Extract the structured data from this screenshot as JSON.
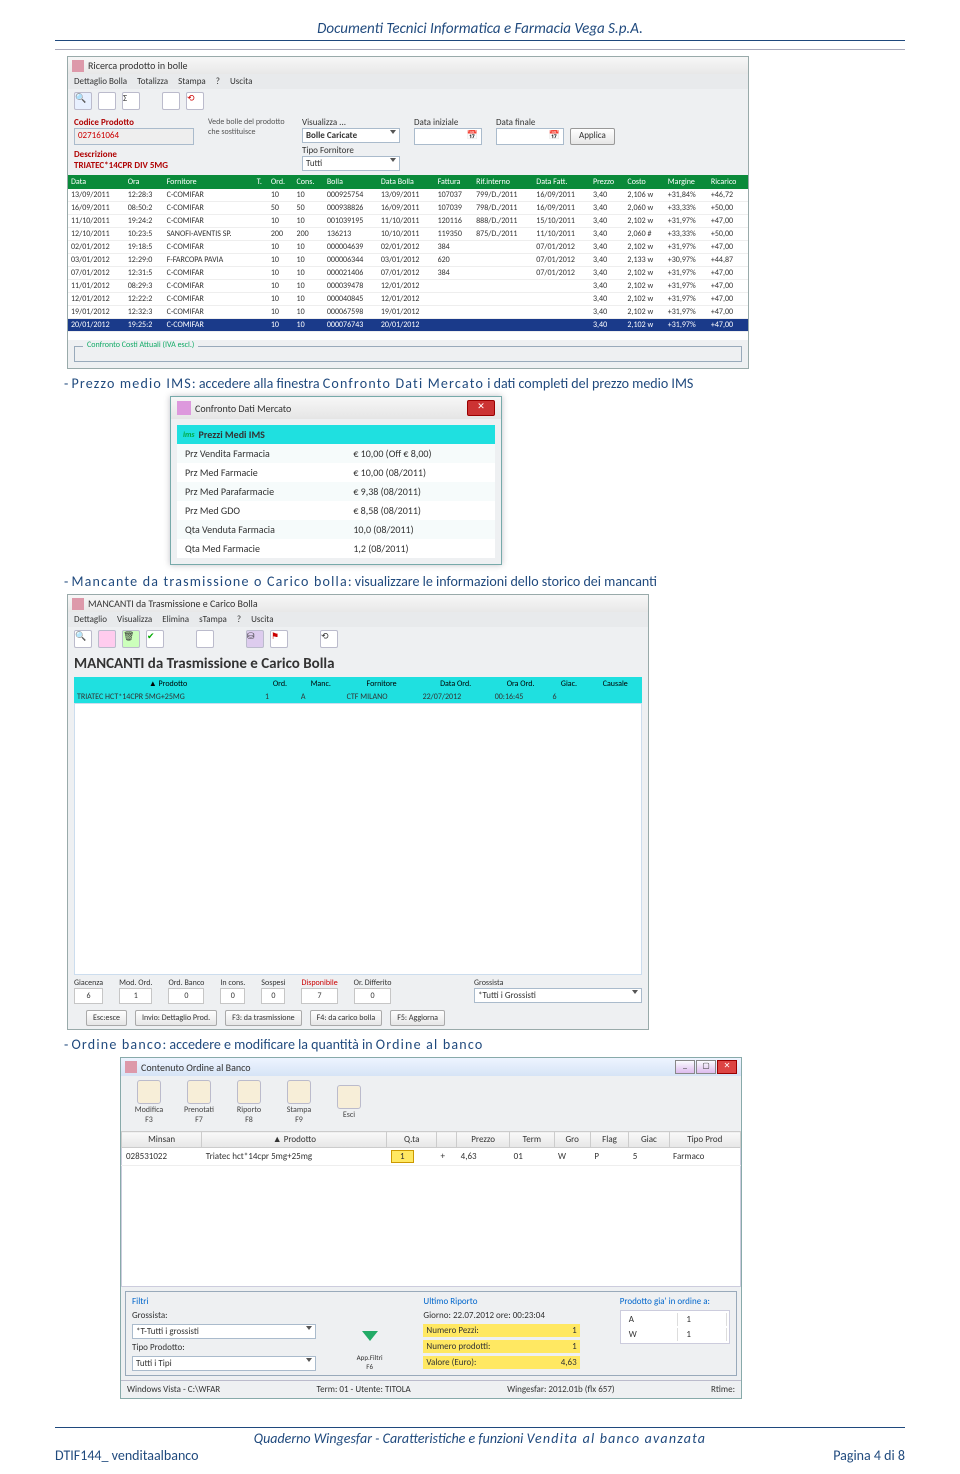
{
  "doc_header": "Documenti Tecnici Informatica e Farmacia Vega S.p.A.",
  "ricerca": {
    "title": "Ricerca prodotto in bolle",
    "menu": [
      "Dettaglio Bolla",
      "Totalizza",
      "Stampa",
      "?",
      "Uscita"
    ],
    "labels": {
      "codice": "Codice Prodotto",
      "codice_val": "027161064",
      "descrizione": "Descrizione",
      "descrizione_val": "TRIATEC*14CPR DIV 5MG",
      "note": "Vede bolle del prodotto che sostituisce",
      "visualizza": "Visualizza ...",
      "bolle_caricate": "Bolle Caricate",
      "tipo_fornitore": "Tipo Fornitore",
      "tutti": "Tutti",
      "data_iniziale": "Data iniziale",
      "data_finale": "Data finale",
      "applica": "Applica"
    },
    "cols": [
      "Data",
      "Ora",
      "Fornitore",
      "T.",
      "Ord.",
      "Cons.",
      "Bolla",
      "Data Bolla",
      "Fattura",
      "Rif.interno",
      "Data Fatt.",
      "Prezzo",
      "Costo",
      "Margine",
      "Ricarico"
    ],
    "rows": [
      [
        "13/09/2011",
        "12:28:3",
        "C-COMIFAR",
        "",
        "10",
        "10",
        "000925754",
        "13/09/2011",
        "107037",
        "799/D./2011",
        "16/09/2011",
        "3,40",
        "2,106 w",
        "+31,84%",
        "+46,72"
      ],
      [
        "16/09/2011",
        "08:50:2",
        "C-COMIFAR",
        "",
        "50",
        "50",
        "000938826",
        "16/09/2011",
        "107039",
        "798/D./2011",
        "16/09/2011",
        "3,40",
        "2,060 w",
        "+33,33%",
        "+50,00"
      ],
      [
        "11/10/2011",
        "19:24:2",
        "C-COMIFAR",
        "",
        "10",
        "10",
        "001039195",
        "11/10/2011",
        "120116",
        "888/D./2011",
        "15/10/2011",
        "3,40",
        "2,102 w",
        "+31,97%",
        "+47,00"
      ],
      [
        "12/10/2011",
        "10:23:5",
        "SANOFI-AVENTIS SP.",
        "",
        "200",
        "200",
        "136213",
        "10/10/2011",
        "119350",
        "875/D./2011",
        "11/10/2011",
        "3,40",
        "2,060 #",
        "+33,33%",
        "+50,00"
      ],
      [
        "02/01/2012",
        "19:18:5",
        "C-COMIFAR",
        "",
        "10",
        "10",
        "000004639",
        "02/01/2012",
        "384",
        "",
        "07/01/2012",
        "3,40",
        "2,102 w",
        "+31,97%",
        "+47,00"
      ],
      [
        "03/01/2012",
        "12:29:0",
        "F-FARCOPA PAVIA",
        "",
        "10",
        "10",
        "000006344",
        "03/01/2012",
        "620",
        "",
        "07/01/2012",
        "3,40",
        "2,133 w",
        "+30,97%",
        "+44,87"
      ],
      [
        "07/01/2012",
        "12:31:5",
        "C-COMIFAR",
        "",
        "10",
        "10",
        "000021406",
        "07/01/2012",
        "384",
        "",
        "07/01/2012",
        "3,40",
        "2,102 w",
        "+31,97%",
        "+47,00"
      ],
      [
        "11/01/2012",
        "08:29:3",
        "C-COMIFAR",
        "",
        "10",
        "10",
        "000039478",
        "12/01/2012",
        "",
        "",
        "",
        "3,40",
        "2,102 w",
        "+31,97%",
        "+47,00"
      ],
      [
        "12/01/2012",
        "12:22:2",
        "C-COMIFAR",
        "",
        "10",
        "10",
        "000040845",
        "12/01/2012",
        "",
        "",
        "",
        "3,40",
        "2,102 w",
        "+31,97%",
        "+47,00"
      ],
      [
        "19/01/2012",
        "12:32:3",
        "C-COMIFAR",
        "",
        "10",
        "10",
        "000067598",
        "19/01/2012",
        "",
        "",
        "",
        "3,40",
        "2,102 w",
        "+31,97%",
        "+47,00"
      ],
      [
        "20/01/2012",
        "19:25:2",
        "C-COMIFAR",
        "",
        "10",
        "10",
        "000076743",
        "20/01/2012",
        "",
        "",
        "",
        "3,40",
        "2,102 w",
        "+31,97%",
        "+47,00"
      ]
    ],
    "groupbox": "Confronto Costi Attuali (IVA escl.)"
  },
  "para1_prefix": "- ",
  "para1_lead": "Prezzo medio IMS",
  "para1_rest": ": accedere alla finestra ",
  "para1_lead2": "Confronto Dati Mercato",
  "para1_rest2": " i dati completi del prezzo medio IMS",
  "confronto": {
    "title": "Confronto Dati Mercato",
    "band": "Prezzi Medi IMS",
    "band_prefix": "ims",
    "rows": [
      [
        "Prz Vendita Farmacia",
        "€ 10,00 (Off € 8,00)"
      ],
      [
        "Prz Med Farmacie",
        "€ 10,00 (08/2011)"
      ],
      [
        "Prz Med Parafarmacie",
        "€ 9,38 (08/2011)"
      ],
      [
        "Prz Med GDO",
        "€ 8,58 (08/2011)"
      ],
      [
        "Qta Venduta Farmacia",
        "10,0 (08/2011)"
      ],
      [
        "Qta Med Farmacie",
        "1,2 (08/2011)"
      ]
    ]
  },
  "para2_prefix": "- ",
  "para2_lead": "Mancante da trasmissione o Carico bolla",
  "para2_rest": ": visualizzare le informazioni dello storico dei mancanti",
  "mancanti": {
    "wintitle": "MANCANTI da Trasmissione e Carico Bolla",
    "menu": [
      "Dettaglio",
      "Visualizza",
      "Elimina",
      "sTampa",
      "?",
      "Uscita"
    ],
    "heading": "MANCANTI da Trasmissione e Carico Bolla",
    "cols": [
      "▲ Prodotto",
      "Ord.",
      "Manc.",
      "Fornitore",
      "Data Ord.",
      "Ora Ord.",
      "Giac.",
      "Causale"
    ],
    "row": [
      "TRIATEC HCT*14CPR 5MG+25MG",
      "1",
      "A",
      "CTF MILANO",
      "22/07/2012",
      "00:16:45",
      "6",
      ""
    ],
    "status_labels": [
      "Giacenza",
      "Mod. Ord.",
      "Ord. Banco",
      "In cons.",
      "Sospesi",
      "Disponibile",
      "Or. Differito"
    ],
    "status_vals": [
      "6",
      "1",
      "0",
      "0",
      "0",
      "7",
      "0"
    ],
    "grossista_lbl": "Grossista",
    "grossista_val": "*Tutti i Grossisti",
    "fbtns": [
      "Esc:esce",
      "Invio: Dettaglio Prod.",
      "F3: da trasmissione",
      "F4: da carico bolla",
      "F5: Aggiorna"
    ]
  },
  "para3_prefix": "- ",
  "para3_lead": "Ordine banco",
  "para3_rest": ": accedere e modificare la quantità in ",
  "para3_lead2": "Ordine al banco",
  "ordine": {
    "wintitle": "Contenuto Ordine al Banco",
    "icons": [
      [
        "Modifica",
        "F3"
      ],
      [
        "Prenotati",
        "F7"
      ],
      [
        "Riporto",
        "F8"
      ],
      [
        "Stampa",
        "F9"
      ],
      [
        "Esci",
        ""
      ]
    ],
    "cols": [
      "Minsan",
      "▲ Prodotto",
      "Q.ta",
      "",
      "Prezzo",
      "Term",
      "Gro",
      "Flag",
      "Giac",
      "Tipo Prod"
    ],
    "row": [
      "028531022",
      "Triatec hct*14cpr 5mg+25mg",
      "1",
      "+",
      "4,63",
      "01",
      "W",
      "P",
      "5",
      "Farmaco"
    ],
    "filtri_leg": "Filtri",
    "grossista_lbl": "Grossista:",
    "grossista_val": "*T-Tutti i grossisti",
    "tipo_lbl": "Tipo Prodotto:",
    "tipo_val": "Tutti i Tipi",
    "appfiltri": "App.Filtri F6",
    "ultimo_leg": "Ultimo Riporto",
    "ultimo_txt": "Giorno: 22.07.2012 ore: 00:23:04",
    "np_lbl": "Numero Pezzi:",
    "np_val": "1",
    "npr_lbl": "Numero prodotti:",
    "npr_val": "1",
    "ve_lbl": "Valore (Euro):",
    "ve_val": "4,63",
    "gia_leg": "Prodotto gia' in ordine a:",
    "gia_rows": [
      [
        "A",
        "1"
      ],
      [
        "W",
        "1"
      ]
    ],
    "status": [
      "Windows Vista - C:\\WFAR",
      "Term: 01 - Utente: TITOLA",
      "Wingesfar: 2012.01b (flx 657)",
      "Rtime:"
    ]
  },
  "footer1": "Quaderno Wingesfar - Caratteristiche e funzioni ",
  "footer1_em": "Vendita al banco avanzata",
  "footer_left": "DTIF144_ venditaalbanco",
  "footer_right": "Pagina 4 di 8"
}
